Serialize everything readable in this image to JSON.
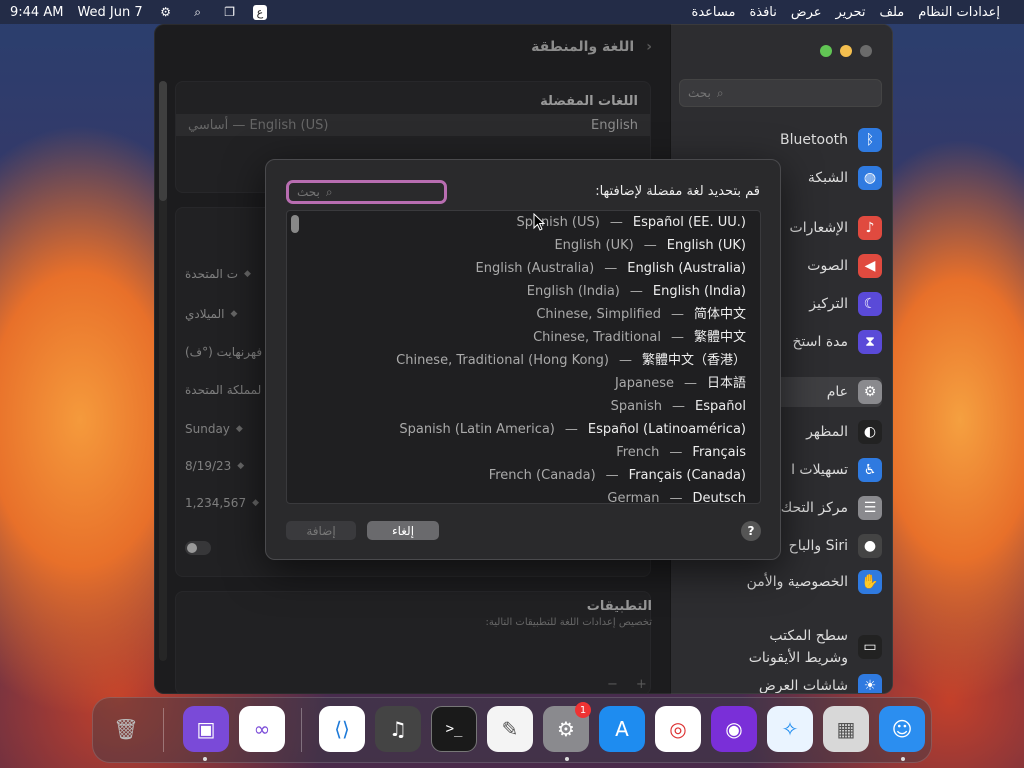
{
  "menubar": {
    "apple": "",
    "app_name": "إعدادات النظام",
    "menus": [
      "ملف",
      "تحرير",
      "عرض",
      "نافذة",
      "مساعدة"
    ],
    "input_lang": "ع",
    "date": "Wed Jun 7",
    "time": "9:44 AM"
  },
  "window": {
    "title": "اللغة والمنطقة",
    "sidebar": {
      "search_placeholder": "بحث",
      "items": [
        {
          "label": "Bluetooth",
          "icon": "bluetooth-icon",
          "color": "#2f7ae0"
        },
        {
          "label": "الشبكة",
          "icon": "globe-icon",
          "color": "#2f7ae0"
        },
        {
          "label": "الإشعارات",
          "icon": "bell-icon",
          "color": "#e04a3f"
        },
        {
          "label": "الصوت",
          "icon": "speaker-icon",
          "color": "#e04a3f"
        },
        {
          "label": "التركيز",
          "icon": "moon-icon",
          "color": "#5a4ad8"
        },
        {
          "label": "مدة استخ",
          "icon": "hourglass-icon",
          "color": "#5a4ad8"
        },
        {
          "label": "عام",
          "icon": "gear-icon",
          "color": "#8a8a8e"
        },
        {
          "label": "المظهر",
          "icon": "appearance-icon",
          "color": "#222"
        },
        {
          "label": "تسهيلات ا",
          "icon": "accessibility-icon",
          "color": "#2f7ae0"
        },
        {
          "label": "مركز التحك",
          "icon": "control-center-icon",
          "color": "#8a8a8e"
        },
        {
          "label": "Siri والباح",
          "icon": "siri-icon",
          "color": "#444"
        },
        {
          "label": "الخصوصية والأمن",
          "icon": "hand-icon",
          "color": "#2f7ae0"
        },
        {
          "label": "سطح المكتب وشريط الأيقونات",
          "icon": "dock-icon",
          "color": "#222"
        },
        {
          "label": "شاشات العرض",
          "icon": "sun-icon",
          "color": "#2f7ae0"
        }
      ]
    },
    "preferred_title": "اللغات المفضلة",
    "preferred_row": {
      "primary": "English",
      "detail": "English (US) — أساسي"
    },
    "fields": [
      "ت المتحدة",
      "الميلادي",
      "فهرنهايت (°ف)",
      "لمملكة المتحدة",
      "Sunday",
      "8/19/23",
      "1,234,567"
    ],
    "apps_title": "التطبيقات",
    "apps_subtitle": "تخصيص إعدادات اللغة للتطبيقات التالية:",
    "apps_add": "+",
    "apps_remove": "−"
  },
  "sheet": {
    "prompt": "قم بتحديد لغة مفضلة لإضافتها:",
    "search_placeholder": "بحث",
    "languages": [
      {
        "en": "Spanish (US)",
        "native": "Español (EE. UU.)"
      },
      {
        "en": "English (UK)",
        "native": "English (UK)"
      },
      {
        "en": "English (Australia)",
        "native": "English (Australia)"
      },
      {
        "en": "English (India)",
        "native": "English (India)"
      },
      {
        "en": "Chinese, Simplified",
        "native": "简体中文"
      },
      {
        "en": "Chinese, Traditional",
        "native": "繁體中文"
      },
      {
        "en": "Chinese, Traditional (Hong Kong)",
        "native": "繁體中文（香港）"
      },
      {
        "en": "Japanese",
        "native": "日本語"
      },
      {
        "en": "Spanish",
        "native": "Español"
      },
      {
        "en": "Spanish (Latin America)",
        "native": "Español (Latinoamérica)"
      },
      {
        "en": "French",
        "native": "Français"
      },
      {
        "en": "French (Canada)",
        "native": "Français (Canada)"
      },
      {
        "en": "German",
        "native": "Deutsch"
      }
    ],
    "separator": "—",
    "add_label": "إضافة",
    "cancel_label": "إلغاء",
    "help_label": "?"
  },
  "dock": {
    "badge_count": "1",
    "apps": [
      {
        "name": "finder-icon",
        "color": "#2b8ef0"
      },
      {
        "name": "launchpad-icon",
        "color": "#d8d8d8"
      },
      {
        "name": "safari-icon",
        "color": "#eaf4ff"
      },
      {
        "name": "firefox-icon",
        "color": "#7a2fd8"
      },
      {
        "name": "chrome-icon",
        "color": "#ffffff"
      },
      {
        "name": "app-store-icon",
        "color": "#1e8cf0"
      },
      {
        "name": "system-settings-icon",
        "color": "#8a8a8e"
      },
      {
        "name": "textedit-icon",
        "color": "#f4f4f4"
      },
      {
        "name": "terminal-icon",
        "color": "#1a1a1a"
      },
      {
        "name": "garageband-icon",
        "color": "#444"
      },
      {
        "name": "vscode-icon",
        "color": "#ffffff"
      },
      {
        "name": "visual-studio-icon",
        "color": "#ffffff"
      },
      {
        "name": "apple-configurator-icon",
        "color": "#7a4ad8"
      },
      {
        "name": "trash-icon",
        "color": "transparent"
      }
    ]
  }
}
